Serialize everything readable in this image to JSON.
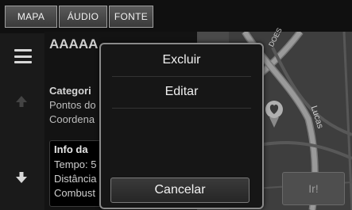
{
  "tabs": [
    {
      "label": "MAPA"
    },
    {
      "label": "ÁUDIO"
    },
    {
      "label": "FONTE"
    }
  ],
  "details": {
    "name": "AAAAA",
    "category_label": "Categori",
    "category_line1": "Pontos do",
    "category_line2": "Coordena",
    "info_title": "Info da",
    "info_lines": [
      "Tempo: 5",
      "Distância",
      "Combust"
    ]
  },
  "map": {
    "street_1": "DOES",
    "street_2": "Lucas"
  },
  "dialog": {
    "items": [
      {
        "label": "Excluir"
      },
      {
        "label": "Editar"
      }
    ],
    "cancel_label": "Cancelar"
  },
  "go_button": {
    "label": "Ir!"
  },
  "colors": {
    "background": "#101010",
    "map_road": "#8a8a8a",
    "pin": "#b0b0b0"
  },
  "icons": [
    "menu-icon",
    "up-arrow-icon",
    "down-arrow-icon",
    "heart-pin-icon"
  ]
}
